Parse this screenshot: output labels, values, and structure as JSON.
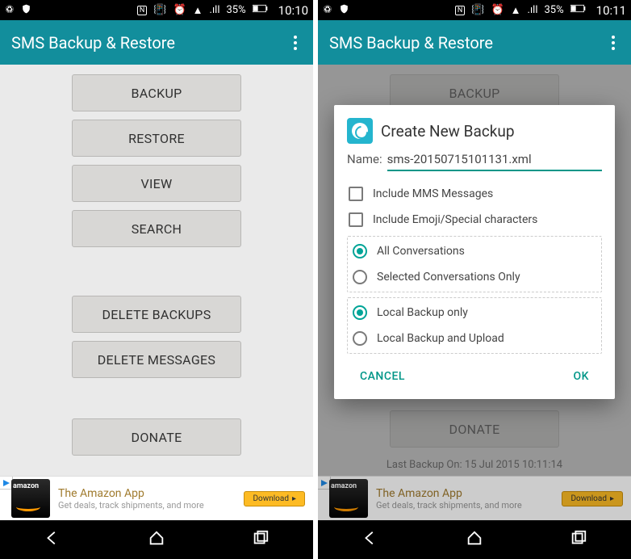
{
  "left": {
    "status": {
      "battery": "35%",
      "clock": "10:10"
    },
    "appbar_title": "SMS Backup & Restore",
    "buttons": {
      "backup": "BACKUP",
      "restore": "RESTORE",
      "view": "VIEW",
      "search": "SEARCH",
      "delete_backups": "DELETE BACKUPS",
      "delete_messages": "DELETE MESSAGES",
      "donate": "DONATE"
    },
    "ad": {
      "title": "The Amazon App",
      "subtitle": "Get deals, track shipments, and more",
      "download": "Download"
    }
  },
  "right": {
    "status": {
      "battery": "35%",
      "clock": "10:11"
    },
    "appbar_title": "SMS Backup & Restore",
    "buttons": {
      "backup": "BACKUP",
      "donate": "DONATE"
    },
    "last_backup": "Last Backup On: 15 Jul 2015 10:11:14",
    "dialog": {
      "title": "Create New Backup",
      "name_label": "Name:",
      "name_value": "sms-20150715101131.xml",
      "opt_mms": "Include MMS Messages",
      "opt_emoji": "Include Emoji/Special characters",
      "opt_all": "All Conversations",
      "opt_selected": "Selected Conversations Only",
      "opt_local": "Local Backup only",
      "opt_upload": "Local Backup and Upload",
      "cancel": "CANCEL",
      "ok": "OK"
    },
    "ad": {
      "title": "The Amazon App",
      "subtitle": "Get deals, track shipments, and more",
      "download": "Download"
    }
  }
}
